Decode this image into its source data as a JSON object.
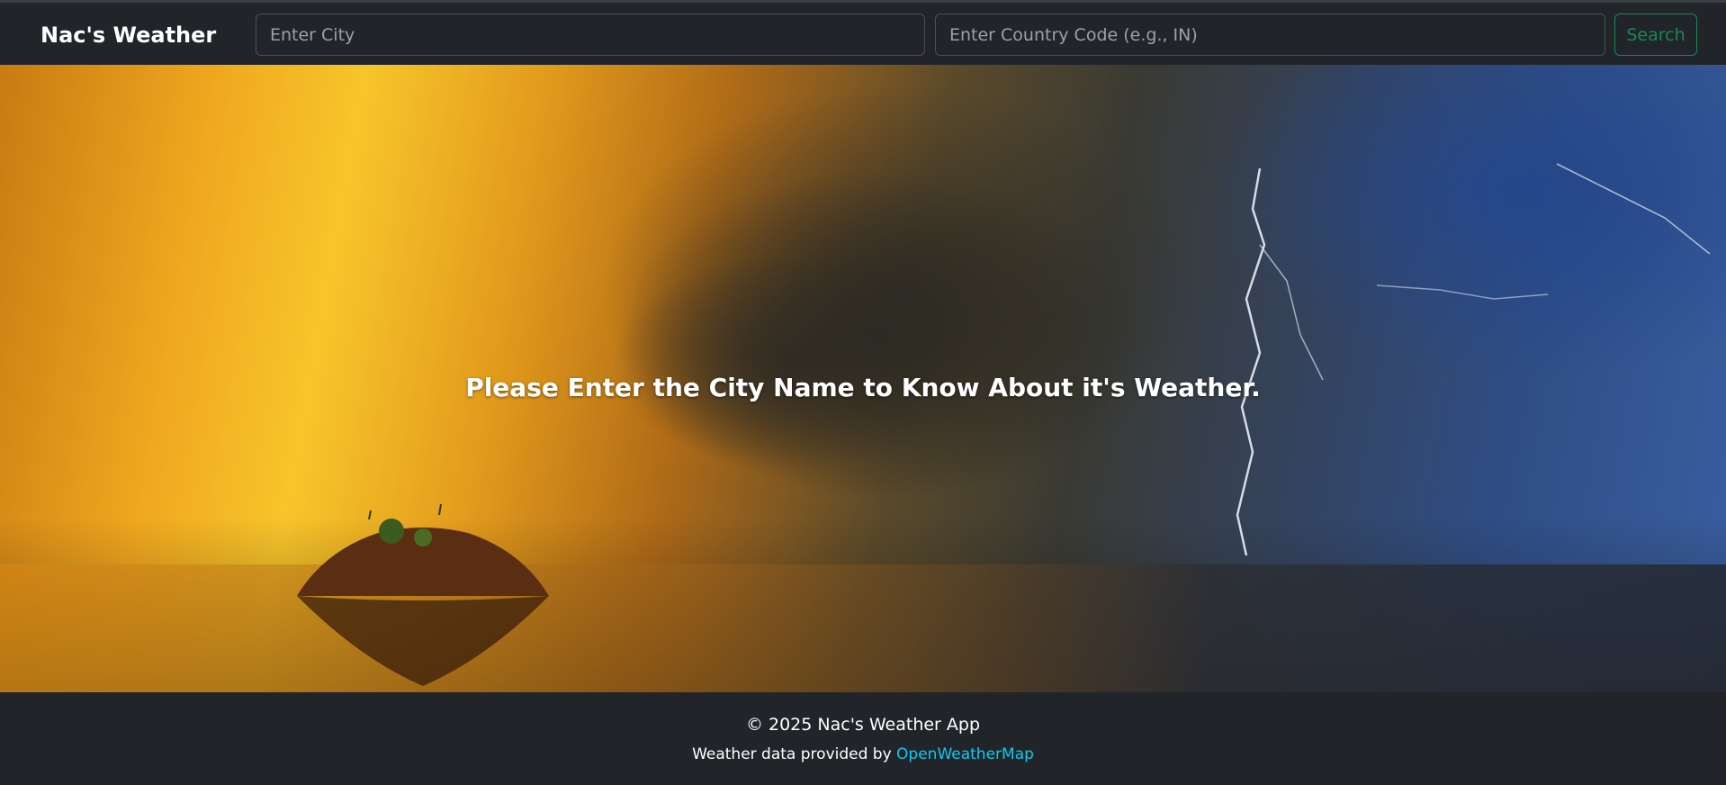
{
  "navbar": {
    "brand": "Nac's Weather",
    "city_placeholder": "Enter City",
    "country_placeholder": "Enter Country Code (e.g., IN)",
    "search_label": "Search"
  },
  "hero": {
    "message": "Please Enter the City Name to Know About it's Weather."
  },
  "footer": {
    "copyright": "© 2025 Nac's Weather App",
    "credit_prefix": "Weather data provided by ",
    "credit_link": "OpenWeatherMap"
  },
  "colors": {
    "navbar_bg": "#212529",
    "search_accent": "#198754",
    "link_accent": "#0dcaf0"
  }
}
